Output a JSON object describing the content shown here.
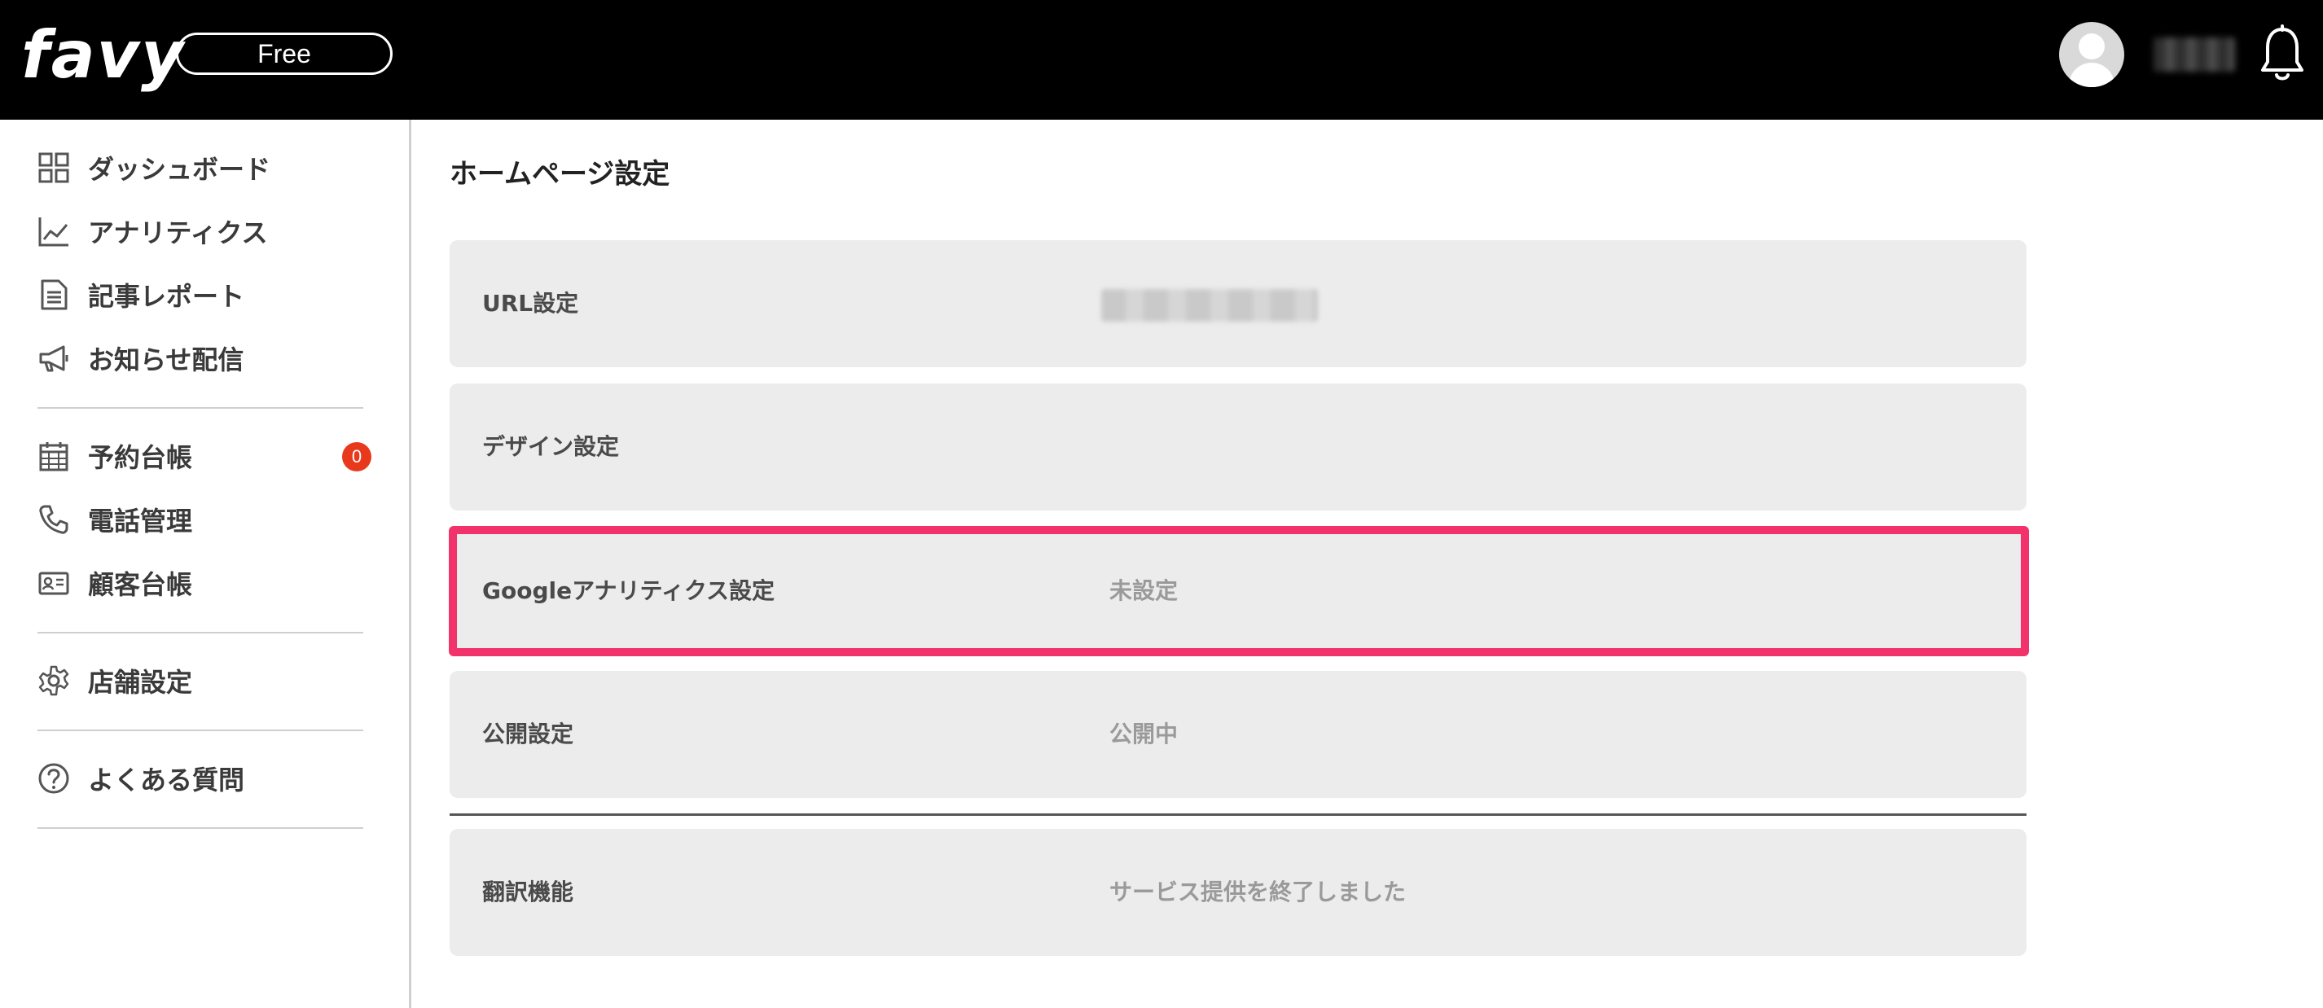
{
  "header": {
    "logo_text": "favy",
    "plan_label": "Free",
    "icons": {
      "avatar": "user-avatar-icon",
      "notifications": "bell-icon"
    }
  },
  "sidebar": {
    "items": [
      {
        "label": "ダッシュボード",
        "icon": "grid-icon"
      },
      {
        "label": "アナリティクス",
        "icon": "line-chart-icon"
      },
      {
        "label": "記事レポート",
        "icon": "document-icon"
      },
      {
        "label": "お知らせ配信",
        "icon": "megaphone-icon"
      },
      {
        "label": "予約台帳",
        "icon": "calendar-icon",
        "badge": "0"
      },
      {
        "label": "電話管理",
        "icon": "phone-icon"
      },
      {
        "label": "顧客台帳",
        "icon": "id-card-icon"
      },
      {
        "label": "店舗設定",
        "icon": "gear-icon"
      },
      {
        "label": "よくある質問",
        "icon": "question-icon"
      }
    ]
  },
  "main": {
    "title": "ホームページ設定",
    "rows": [
      {
        "label": "URL設定",
        "value": ""
      },
      {
        "label": "デザイン設定",
        "value": ""
      },
      {
        "label": "Googleアナリティクス設定",
        "value": "未設定"
      },
      {
        "label": "公開設定",
        "value": "公開中"
      },
      {
        "label": "翻訳機能",
        "value": "サービス提供を終了しました"
      }
    ]
  },
  "colors": {
    "header_bg": "#000000",
    "highlight": "#f2336b",
    "badge": "#e8391c",
    "row_bg": "#ececec"
  }
}
